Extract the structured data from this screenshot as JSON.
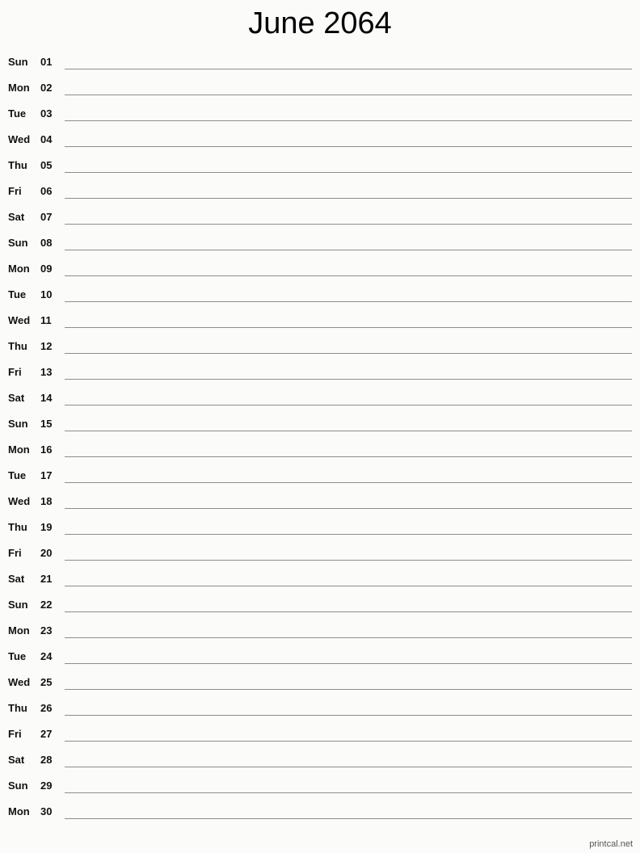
{
  "title": "June 2064",
  "days": [
    {
      "dow": "Sun",
      "day": "01"
    },
    {
      "dow": "Mon",
      "day": "02"
    },
    {
      "dow": "Tue",
      "day": "03"
    },
    {
      "dow": "Wed",
      "day": "04"
    },
    {
      "dow": "Thu",
      "day": "05"
    },
    {
      "dow": "Fri",
      "day": "06"
    },
    {
      "dow": "Sat",
      "day": "07"
    },
    {
      "dow": "Sun",
      "day": "08"
    },
    {
      "dow": "Mon",
      "day": "09"
    },
    {
      "dow": "Tue",
      "day": "10"
    },
    {
      "dow": "Wed",
      "day": "11"
    },
    {
      "dow": "Thu",
      "day": "12"
    },
    {
      "dow": "Fri",
      "day": "13"
    },
    {
      "dow": "Sat",
      "day": "14"
    },
    {
      "dow": "Sun",
      "day": "15"
    },
    {
      "dow": "Mon",
      "day": "16"
    },
    {
      "dow": "Tue",
      "day": "17"
    },
    {
      "dow": "Wed",
      "day": "18"
    },
    {
      "dow": "Thu",
      "day": "19"
    },
    {
      "dow": "Fri",
      "day": "20"
    },
    {
      "dow": "Sat",
      "day": "21"
    },
    {
      "dow": "Sun",
      "day": "22"
    },
    {
      "dow": "Mon",
      "day": "23"
    },
    {
      "dow": "Tue",
      "day": "24"
    },
    {
      "dow": "Wed",
      "day": "25"
    },
    {
      "dow": "Thu",
      "day": "26"
    },
    {
      "dow": "Fri",
      "day": "27"
    },
    {
      "dow": "Sat",
      "day": "28"
    },
    {
      "dow": "Sun",
      "day": "29"
    },
    {
      "dow": "Mon",
      "day": "30"
    }
  ],
  "footer": "printcal.net"
}
